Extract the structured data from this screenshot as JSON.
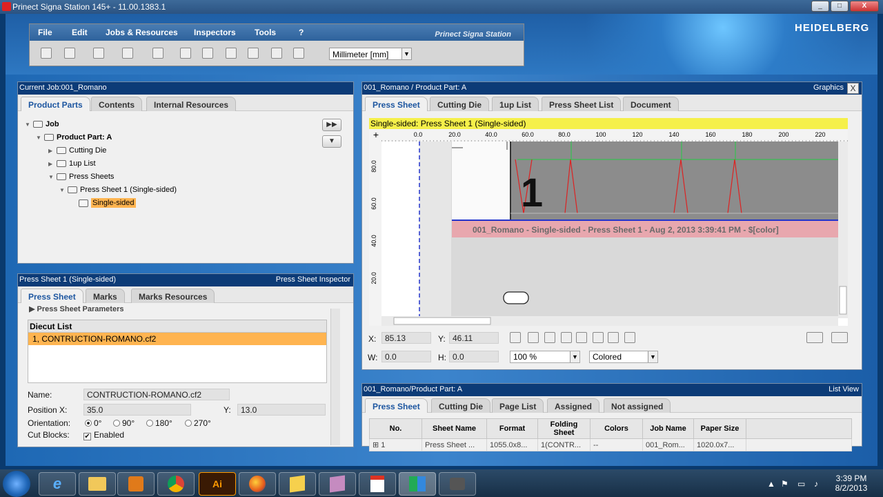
{
  "window": {
    "title": "Prinect Signa Station 145+  -  11.00.1383.1",
    "brand": "HEIDELBERG",
    "signature": "Prinect Signa Station",
    "controls": [
      "_",
      "□",
      "X"
    ]
  },
  "menu": {
    "items": [
      "File",
      "Edit",
      "Jobs & Resources",
      "Inspectors",
      "Tools",
      "?"
    ]
  },
  "toolbar": {
    "units": "Millimeter [mm]",
    "units_arrow": "▼"
  },
  "job_panel": {
    "title": "Current Job:001_Romano",
    "tabs": [
      "Product Parts",
      "Contents",
      "Internal Resources"
    ],
    "tree": {
      "job": "Job",
      "part": "Product Part: A",
      "cutting_die": "Cutting Die",
      "oneup": "1up List",
      "press_sheets": "Press Sheets",
      "press_sheet_1": "Press Sheet 1 (Single-sided)",
      "single": "Single-sided"
    },
    "btn_forward": "▶▶",
    "btn_down": "▼"
  },
  "inspector": {
    "title": "Press Sheet 1 (Single-sided)",
    "title_right": "Press Sheet Inspector",
    "tabs": [
      "Press Sheet",
      "Marks",
      "Marks Resources"
    ],
    "section": "Press Sheet Parameters",
    "diecut_header": "Diecut List",
    "diecut_item": "1, CONTRUCTION-ROMANO.cf2",
    "name_label": "Name:",
    "name_value": "CONTRUCTION-ROMANO.cf2",
    "posx_label": "Position X:",
    "posx_value": "35.0",
    "posy_label": "Y:",
    "posy_value": "13.0",
    "orient_label": "Orientation:",
    "orientations": [
      "0°",
      "90°",
      "180°",
      "270°"
    ],
    "cut_label": "Cut Blocks:",
    "cut_value": "Enabled"
  },
  "graphics": {
    "title": "001_Romano / Product Part: A",
    "title_right": "Graphics",
    "close": "X",
    "tabs": [
      "Press Sheet",
      "Cutting Die",
      "1up List",
      "Press Sheet List",
      "Document"
    ],
    "banner": "Single-sided:  Press Sheet 1 (Single-sided)",
    "hruler": [
      "0.0",
      "20.0",
      "40.0",
      "60.0",
      "80.0",
      "100",
      "120",
      "140",
      "160",
      "180",
      "200",
      "220"
    ],
    "vruler": [
      "80.0",
      "60.0",
      "40.0",
      "20.0"
    ],
    "sheet_number": "1",
    "slug": "001_Romano - Single-sided     - Press Sheet 1 - Aug 2, 2013 3:39:41 PM - $[color]",
    "x_label": "X:",
    "x_value": "85.13",
    "y_label": "Y:",
    "y_value": "46.11",
    "w_label": "W:",
    "w_value": "0.0",
    "h_label": "H:",
    "h_value": "0.0",
    "zoom": "100 %",
    "mode": "Colored"
  },
  "list_view": {
    "title": "001_Romano/Product Part: A",
    "title_right": "List View",
    "tabs": [
      "Press Sheet",
      "Cutting Die",
      "Page List",
      "Assigned",
      "Not assigned"
    ],
    "columns": [
      "No.",
      "Sheet Name",
      "Format",
      "Folding Sheet",
      "Colors",
      "Job Name",
      "Paper Size"
    ],
    "rows": [
      [
        "1",
        "Press Sheet ...",
        "1055.0x8...",
        "1(CONTR...",
        "--",
        "001_Rom...",
        "1020.0x7..."
      ]
    ]
  },
  "taskbar": {
    "time": "3:39 PM",
    "date": "8/2/2013",
    "apps": [
      "e",
      "",
      "",
      "",
      "Ai",
      "",
      "",
      "",
      "",
      ""
    ]
  },
  "colors": {
    "header": "#0c3b77",
    "accent": "#1d56a0",
    "selection": "#ffb450",
    "banner": "#f5f04a",
    "slug": "#e8a7ae"
  }
}
